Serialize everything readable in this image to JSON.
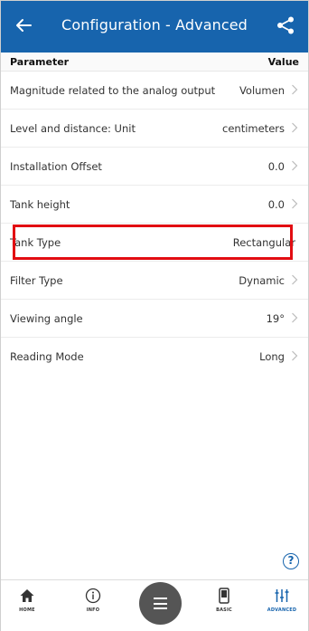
{
  "header": {
    "title": "Configuration - Advanced",
    "back_icon": "arrow-left-icon",
    "share_icon": "share-icon",
    "color": "#1764ad"
  },
  "table": {
    "col_parameter": "Parameter",
    "col_value": "Value",
    "rows": [
      {
        "label": "Magnitude related to the analog output",
        "value": "Volumen",
        "arrow": true
      },
      {
        "label": "Level and distance: Unit",
        "value": "centimeters",
        "arrow": true
      },
      {
        "label": "Installation Offset",
        "value": "0.0",
        "arrow": true
      },
      {
        "label": "Tank height",
        "value": "0.0",
        "arrow": true
      },
      {
        "label": "Tank Type",
        "value": "Rectangular",
        "arrow": false
      },
      {
        "label": "Filter Type",
        "value": "Dynamic",
        "arrow": true
      },
      {
        "label": "Viewing angle",
        "value": "19°",
        "arrow": true
      },
      {
        "label": "Reading Mode",
        "value": "Long",
        "arrow": true
      }
    ]
  },
  "highlight_color": "#e20d12",
  "help": {
    "icon": "help-icon",
    "glyph": "?"
  },
  "bottom_nav": {
    "items": [
      {
        "label": "HOME",
        "icon": "home-icon"
      },
      {
        "label": "INFO",
        "icon": "info-icon"
      },
      {
        "label": "BASIC",
        "icon": "device-icon"
      },
      {
        "label": "ADVANCED",
        "icon": "sliders-icon",
        "active": true
      }
    ],
    "center_icon": "menu-icon"
  }
}
